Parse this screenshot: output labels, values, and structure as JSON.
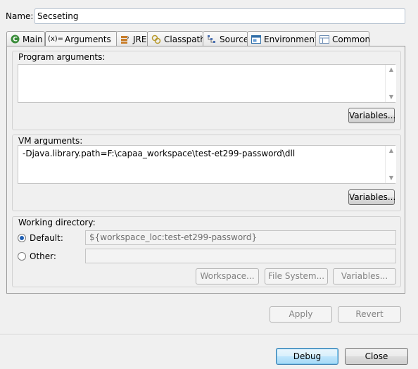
{
  "header": {
    "name_label": "Name:",
    "name_value": "Secseting"
  },
  "tabs": [
    {
      "label": "Main",
      "icon": "main-class-icon",
      "active": false
    },
    {
      "label": "Arguments",
      "icon": "arguments-icon",
      "active": true
    },
    {
      "label": "JRE",
      "icon": "jre-icon",
      "active": false
    },
    {
      "label": "Classpath",
      "icon": "classpath-icon",
      "active": false
    },
    {
      "label": "Source",
      "icon": "source-icon",
      "active": false
    },
    {
      "label": "Environment",
      "icon": "environment-icon",
      "active": false
    },
    {
      "label": "Common",
      "icon": "common-icon",
      "active": false
    }
  ],
  "program_args": {
    "title": "Program arguments:",
    "value": "",
    "variables_button": "Variables..."
  },
  "vm_args": {
    "title": "VM arguments:",
    "value": "-Djava.library.path=F:\\capaa_workspace\\test-et299-password\\dll",
    "variables_button": "Variables..."
  },
  "working_dir": {
    "title": "Working directory:",
    "default_label": "Default:",
    "default_value": "${workspace_loc:test-et299-password}",
    "other_label": "Other:",
    "other_value": "",
    "selected": "default",
    "workspace_button": "Workspace...",
    "filesystem_button": "File System...",
    "variables_button": "Variables..."
  },
  "footer": {
    "apply_label": "Apply",
    "revert_label": "Revert",
    "debug_label": "Debug",
    "close_label": "Close"
  },
  "colors": {
    "main_icon": "#3a8c3a",
    "jre_icon": "#c87d2a",
    "classpath_icon": "#b89a2c",
    "source_icon": "#4a6fb0",
    "environment_icon": "#2f6ea8",
    "common_icon": "#6f8fb5",
    "radio_selected": "#1f5fb3"
  }
}
